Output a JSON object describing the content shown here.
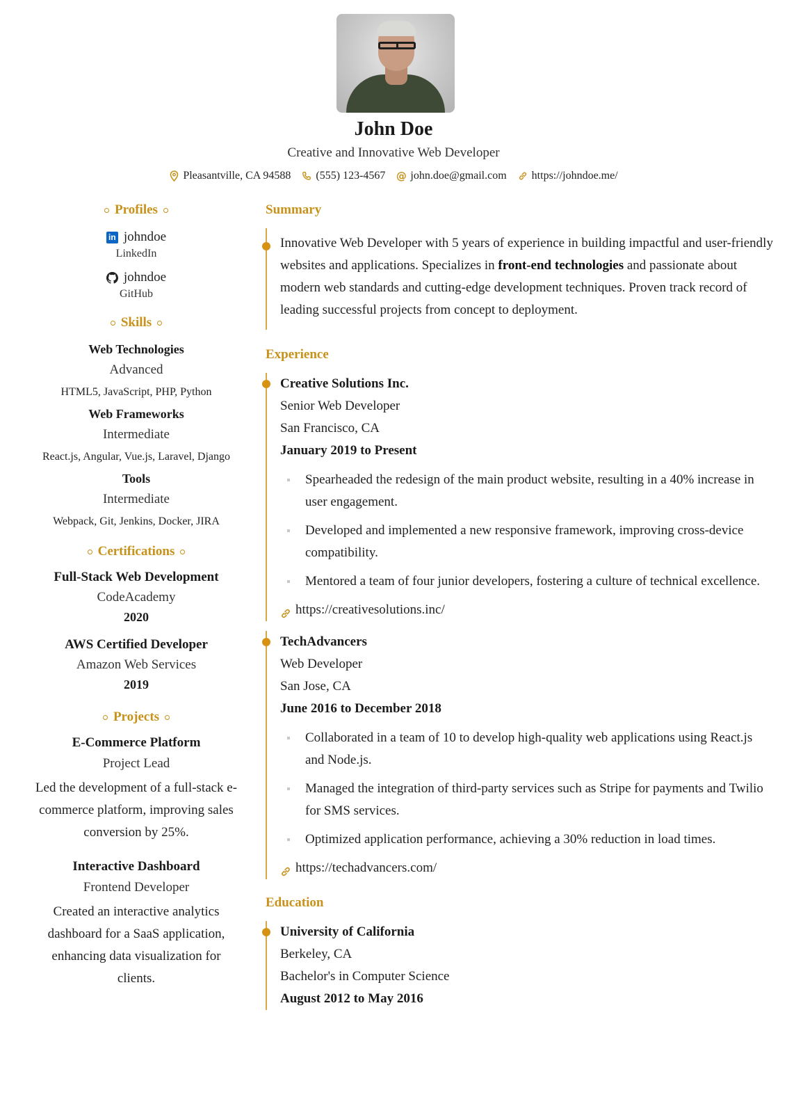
{
  "header": {
    "name": "John Doe",
    "headline": "Creative and Innovative Web Developer",
    "contacts": [
      {
        "icon": "map-pin-icon",
        "text": "Pleasantville, CA 94588"
      },
      {
        "icon": "phone-icon",
        "text": "(555) 123-4567"
      },
      {
        "icon": "at-sign-icon",
        "text": "john.doe@gmail.com"
      },
      {
        "icon": "link-icon",
        "text": "https://johndoe.me/"
      }
    ]
  },
  "colors": {
    "accent": "#c8921a",
    "timeline_dot": "#d69212",
    "timeline_line": "#d8a94a",
    "linkedin": "#0a66c2"
  },
  "left": {
    "profiles_title": "Profiles",
    "profiles": [
      {
        "icon": "linkedin-icon",
        "username": "johndoe",
        "network": "LinkedIn"
      },
      {
        "icon": "github-icon",
        "username": "johndoe",
        "network": "GitHub"
      }
    ],
    "skills_title": "Skills",
    "skills": [
      {
        "name": "Web Technologies",
        "level": "Advanced",
        "keywords": "HTML5, JavaScript, PHP, Python"
      },
      {
        "name": "Web Frameworks",
        "level": "Intermediate",
        "keywords": "React.js, Angular, Vue.js, Laravel, Django"
      },
      {
        "name": "Tools",
        "level": "Intermediate",
        "keywords": "Webpack, Git, Jenkins, Docker, JIRA"
      }
    ],
    "certifications_title": "Certifications",
    "certifications": [
      {
        "name": "Full-Stack Web Development",
        "issuer": "CodeAcademy",
        "date": "2020"
      },
      {
        "name": "AWS Certified Developer",
        "issuer": "Amazon Web Services",
        "date": "2019"
      }
    ],
    "projects_title": "Projects",
    "projects": [
      {
        "name": "E-Commerce Platform",
        "role": "Project Lead",
        "description": "Led the development of a full-stack e-commerce platform, improving sales conversion by 25%."
      },
      {
        "name": "Interactive Dashboard",
        "role": "Frontend Developer",
        "description": "Created an interactive analytics dashboard for a SaaS application, enhancing data visualization for clients."
      }
    ]
  },
  "right": {
    "summary_title": "Summary",
    "summary": {
      "part1": "Innovative Web Developer with 5 years of experience in building impactful and user-friendly websites and applications. Specializes in ",
      "bold": "front-end technologies",
      "part2": " and passionate about modern web standards and cutting-edge development techniques. Proven track record of leading successful projects from concept to deployment."
    },
    "experience_title": "Experience",
    "experience": [
      {
        "company": "Creative Solutions Inc.",
        "position": "Senior Web Developer",
        "location": "San Francisco, CA",
        "date": "January 2019 to Present",
        "highlights": [
          "Spearheaded the redesign of the main product website, resulting in a 40% increase in user engagement.",
          "Developed and implemented a new responsive framework, improving cross-device compatibility.",
          "Mentored a team of four junior developers, fostering a culture of technical excellence."
        ],
        "url": "https://creativesolutions.inc/"
      },
      {
        "company": "TechAdvancers",
        "position": "Web Developer",
        "location": "San Jose, CA",
        "date": "June 2016 to December 2018",
        "highlights": [
          "Collaborated in a team of 10 to develop high-quality web applications using React.js and Node.js.",
          "Managed the integration of third-party services such as Stripe for payments and Twilio for SMS services.",
          "Optimized application performance, achieving a 30% reduction in load times."
        ],
        "url": "https://techadvancers.com/"
      }
    ],
    "education_title": "Education",
    "education": [
      {
        "institution": "University of California",
        "location": "Berkeley, CA",
        "degree": "Bachelor's in Computer Science",
        "date": "August 2012 to May 2016"
      }
    ]
  }
}
